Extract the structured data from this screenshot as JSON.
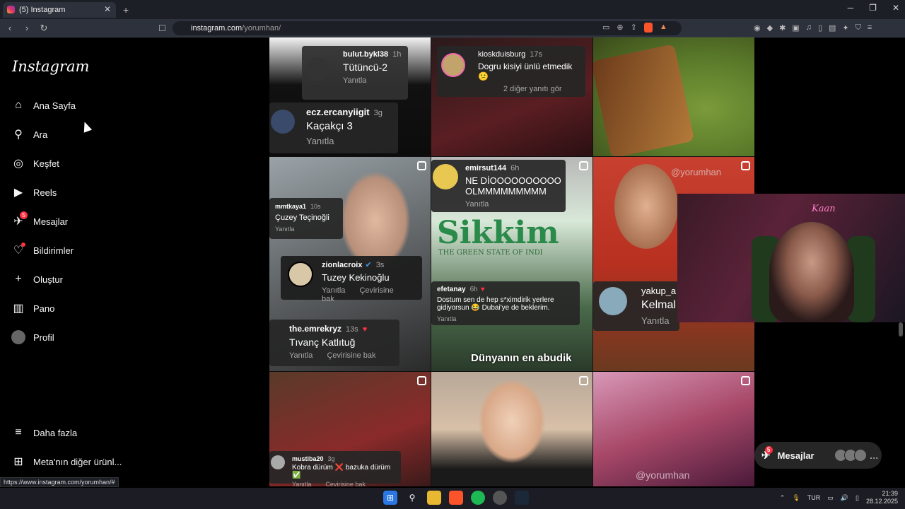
{
  "browser": {
    "tab_title": "(5) Instagram",
    "tab_close": "✕",
    "new_tab": "+",
    "url_host": "instagram.com",
    "url_path": "/yorumhan/",
    "status_url": "https://www.instagram.com/yorumhan/#"
  },
  "sidebar": {
    "logo": "Instagram",
    "items": [
      {
        "label": "Ana Sayfa"
      },
      {
        "label": "Ara"
      },
      {
        "label": "Keşfet"
      },
      {
        "label": "Reels"
      },
      {
        "label": "Mesajlar",
        "badge": "5"
      },
      {
        "label": "Bildirimler"
      },
      {
        "label": "Oluştur"
      },
      {
        "label": "Pano"
      },
      {
        "label": "Profil"
      }
    ],
    "more": "Daha fazla",
    "meta": "Meta'nın diğer ürünl..."
  },
  "posts": {
    "c1": {
      "user": "bulut.bykl38",
      "time": "1h",
      "text": "Tütüncü-2",
      "reply": "Yanıtla"
    },
    "c2": {
      "user": "kioskduisburg",
      "time": "17s",
      "text": "Dogru kisiyi ünlü etmedik😕",
      "more": "2 diğer yanıtı gör"
    },
    "c3": {
      "user": "ecz.ercanyiigit",
      "time": "3g",
      "text": "Kaçakçı 3",
      "reply": "Yanıtla"
    },
    "c4": {
      "user": "mmtkaya1",
      "time": "10s",
      "text": "Çuzey Teçinoğli",
      "reply": "Yanıtla"
    },
    "c5": {
      "user": "zionlacroix",
      "time": "3s",
      "text": "Tuzey Kekinoğlu",
      "reply": "Yanıtla",
      "translate": "Çevirisine bak"
    },
    "c6": {
      "user": "emirsut144",
      "time": "6h",
      "text": "NE DİOOOOOOOOOO OLMMMMMMMMM",
      "reply": "Yanıtla"
    },
    "c7": {
      "user": "efetanay",
      "time": "6h",
      "text": "Dostum sen de hep s*ximdirik yerlere gidiyorsun 😂 Dubai'ye de beklerim.",
      "reply": "Yanıtla"
    },
    "c8": {
      "user": "the.emrekryz",
      "time": "13s",
      "text": "Tıvanç Katlıtuğ",
      "reply": "Yanıtla",
      "translate": "Çevirisine bak"
    },
    "c9": {
      "user": "yakup_a",
      "text": "Kelmal",
      "reply": "Yanıtla"
    },
    "c10": {
      "user": "mustiba20",
      "time": "3g",
      "text": "Kobra dürüm ❌ bazuka dürüm ✅",
      "reply": "Yanıtla",
      "translate": "Çevirisine bak"
    },
    "overlay_sikkim": "Sikkim",
    "overlay_sikkim_sub": "THE GREEN STATE OF INDI",
    "overlay_dunya": "Dünyanın en abudik",
    "watermark": "@yorumhan"
  },
  "webcam": {
    "neon": "Kaan"
  },
  "messages_button": {
    "label": "Mesajlar",
    "badge": "5"
  },
  "taskbar": {
    "lang": "TUR",
    "time": "21:39",
    "date": "28.12.2025"
  },
  "colors": {
    "accent_red": "#ff3040",
    "bg": "#000000"
  }
}
